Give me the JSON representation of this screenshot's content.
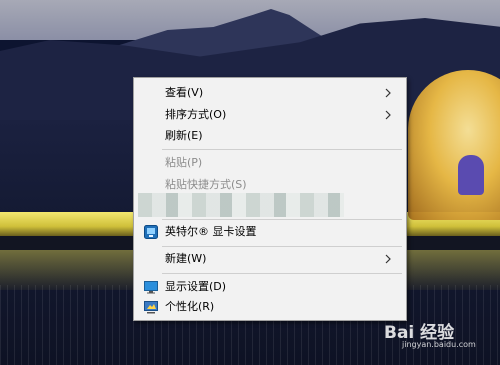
{
  "context_menu": {
    "items": [
      {
        "label": "查看(V)",
        "submenu": true,
        "enabled": true
      },
      {
        "label": "排序方式(O)",
        "submenu": true,
        "enabled": true
      },
      {
        "label": "刷新(E)",
        "submenu": false,
        "enabled": true
      },
      {
        "label": "粘贴(P)",
        "submenu": false,
        "enabled": false
      },
      {
        "label": "粘贴快捷方式(S)",
        "submenu": false,
        "enabled": false
      },
      {
        "label": "英特尔® 显卡设置",
        "submenu": false,
        "enabled": true,
        "icon": "intel-graphics-icon"
      },
      {
        "label": "新建(W)",
        "submenu": true,
        "enabled": true
      },
      {
        "label": "显示设置(D)",
        "submenu": false,
        "enabled": true,
        "icon": "display-settings-icon"
      },
      {
        "label": "个性化(R)",
        "submenu": false,
        "enabled": true,
        "icon": "personalize-icon"
      }
    ]
  },
  "watermark": {
    "brand": "Bai 经验",
    "url": "jingyan.baidu.com"
  },
  "colors": {
    "menu_background": "#f2f2f2",
    "disabled_text": "#8c8c8c",
    "separator": "#cfcfcf"
  }
}
